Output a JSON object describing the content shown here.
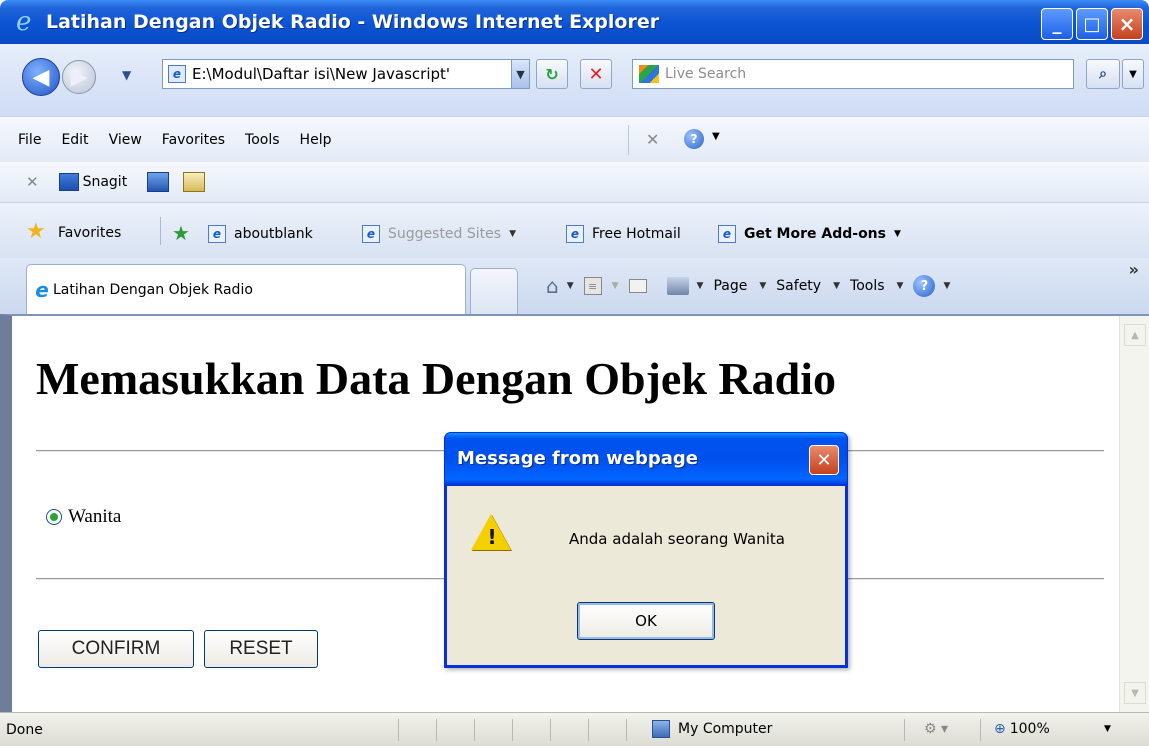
{
  "window": {
    "title": "Latihan Dengan Objek Radio - Windows Internet Explorer"
  },
  "address_bar": {
    "url": "E:\\Modul\\Daftar isi\\New Javascript'",
    "search_placeholder": "Live Search"
  },
  "menu": {
    "items": [
      "File",
      "Edit",
      "View",
      "Favorites",
      "Tools",
      "Help"
    ]
  },
  "toolbar": {
    "snagit_label": "Snagit"
  },
  "favorites_bar": {
    "favorites_label": "Favorites",
    "links": [
      "aboutblank",
      "Suggested Sites",
      "Free Hotmail",
      "Get More Add-ons"
    ]
  },
  "tabs": {
    "active_tab": "Latihan Dengan Objek Radio"
  },
  "command_bar": {
    "page": "Page",
    "safety": "Safety",
    "tools": "Tools"
  },
  "page": {
    "heading": "Memasukkan Data Dengan Objek Radio",
    "radio_label": "Wanita",
    "confirm_button": "CONFIRM",
    "reset_button": "RESET"
  },
  "dialog": {
    "title": "Message from webpage",
    "message": "Anda adalah seorang Wanita",
    "ok_button": "OK"
  },
  "status_bar": {
    "status": "Done",
    "zone": "My Computer",
    "zoom": "100%"
  }
}
